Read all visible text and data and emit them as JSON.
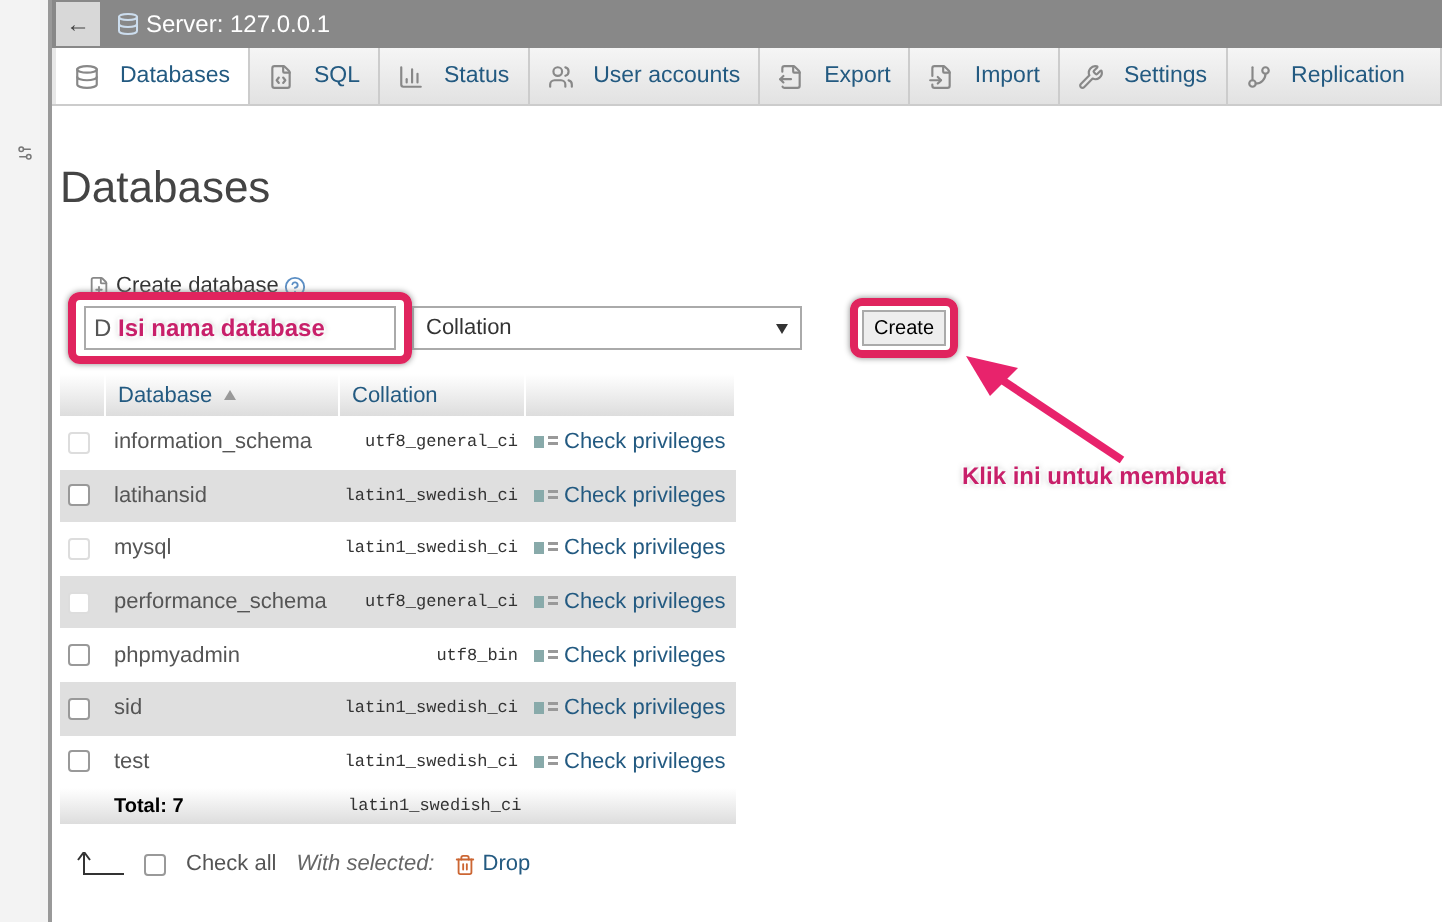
{
  "header": {
    "back_label": "←",
    "title": "Server: 127.0.0.1"
  },
  "tabs": [
    {
      "label": "Databases",
      "selected": true
    },
    {
      "label": "SQL",
      "selected": false
    },
    {
      "label": "Status",
      "selected": false
    },
    {
      "label": "User accounts",
      "selected": false
    },
    {
      "label": "Export",
      "selected": false
    },
    {
      "label": "Import",
      "selected": false
    },
    {
      "label": "Settings",
      "selected": false
    },
    {
      "label": "Replication",
      "selected": false
    }
  ],
  "heading": "Databases",
  "create": {
    "label": "Create database",
    "name_placeholder": "D",
    "collation": "Collation",
    "button": "Create"
  },
  "table": {
    "columns": [
      "Database",
      "Collation"
    ],
    "rows": [
      {
        "name": "information_schema",
        "collation": "utf8_general_ci",
        "action": "Check privileges",
        "checked": false,
        "disabled": true
      },
      {
        "name": "latihansid",
        "collation": "latin1_swedish_ci",
        "action": "Check privileges",
        "checked": false,
        "disabled": false
      },
      {
        "name": "mysql",
        "collation": "latin1_swedish_ci",
        "action": "Check privileges",
        "checked": false,
        "disabled": true
      },
      {
        "name": "performance_schema",
        "collation": "utf8_general_ci",
        "action": "Check privileges",
        "checked": false,
        "disabled": true
      },
      {
        "name": "phpmyadmin",
        "collation": "utf8_bin",
        "action": "Check privileges",
        "checked": false,
        "disabled": false
      },
      {
        "name": "sid",
        "collation": "latin1_swedish_ci",
        "action": "Check privileges",
        "checked": false,
        "disabled": false
      },
      {
        "name": "test",
        "collation": "latin1_swedish_ci",
        "action": "Check privileges",
        "checked": false,
        "disabled": false
      }
    ],
    "total_label": "Total: 7",
    "total_collation": "latin1_swedish_ci"
  },
  "footer": {
    "check_all": "Check all",
    "check_all_checked": false,
    "with_selected": "With selected:",
    "drop": "Drop"
  },
  "annotations": [
    {
      "kind": "input_note",
      "text": "Isi nama database"
    },
    {
      "kind": "button_note",
      "text": "Klik ini untuk membuat"
    }
  ]
}
